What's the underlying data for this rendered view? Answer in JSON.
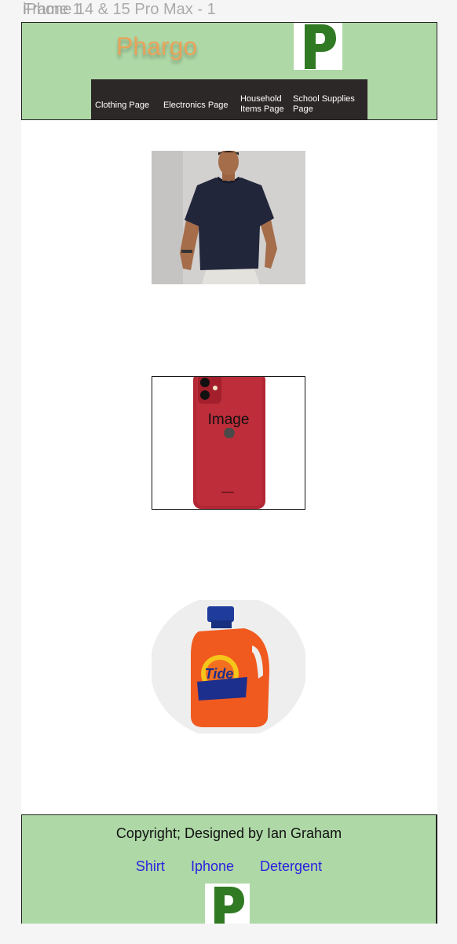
{
  "frame": {
    "title": "iPhone 14 & 15 Pro Max - 1",
    "overlap_title": "Frame 1"
  },
  "header": {
    "brand": "Phargo",
    "logo_letter": "P",
    "nav": [
      {
        "label": "Clothing Page"
      },
      {
        "label": "Electronics Page"
      },
      {
        "label": "Household Items Page"
      },
      {
        "label": "School Supplies Page"
      }
    ]
  },
  "products": {
    "shirt": {
      "icon": "tshirt-photo"
    },
    "iphone": {
      "icon": "iphone-photo",
      "caption": "Image"
    },
    "detergent": {
      "icon": "detergent-photo",
      "brand_text": "Tide"
    }
  },
  "footer": {
    "copyright": "Copyright; Designed by Ian Graham",
    "links": [
      "Shirt",
      "Iphone",
      "Detergent"
    ],
    "logo_letter": "P"
  },
  "colors": {
    "header_bg": "#aed8a6",
    "brand": "#e8a35a",
    "nav_bg": "#2d2828",
    "logo_green": "#2f7a23",
    "link": "#2a1ee0"
  }
}
